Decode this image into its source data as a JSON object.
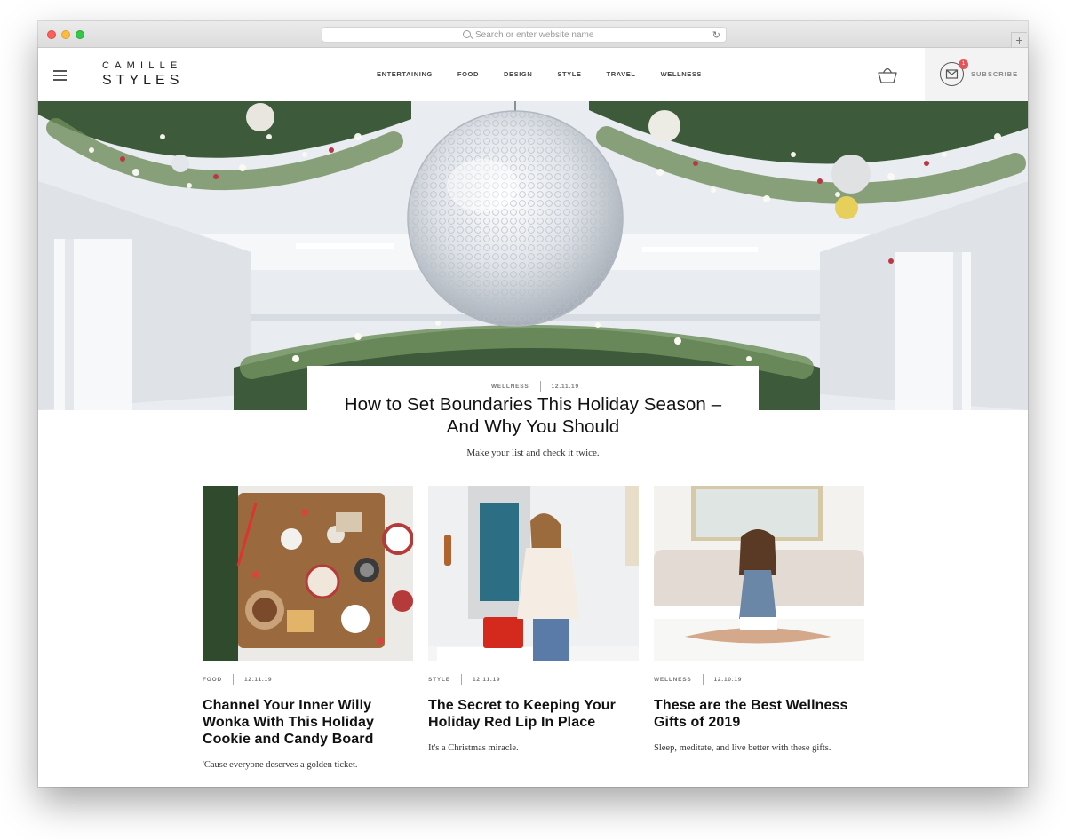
{
  "browser": {
    "url_placeholder": "Search or enter website name",
    "reload_icon": "reload-icon",
    "new_tab_label": "+"
  },
  "site": {
    "logo_line1": "CAMILLE",
    "logo_line2": "STYLES",
    "nav": [
      "ENTERTAINING",
      "FOOD",
      "DESIGN",
      "STYLE",
      "TRAVEL",
      "WELLNESS"
    ],
    "subscribe_label": "SUBSCRIBE",
    "subscribe_badge": "1",
    "icons": [
      "hamburger-menu-icon",
      "shopping-basket-icon",
      "envelope-icon"
    ]
  },
  "hero": {
    "category": "WELLNESS",
    "date": "12.11.19",
    "title": "How to Set Boundaries This Holiday Season – And Why You Should",
    "subtitle": "Make your list and check it twice."
  },
  "posts": [
    {
      "category": "FOOD",
      "date": "12.11.19",
      "title": "Channel Your Inner Willy Wonka With This Holiday Cookie and Candy Board",
      "excerpt": "'Cause everyone deserves a golden ticket."
    },
    {
      "category": "STYLE",
      "date": "12.11.19",
      "title": "The Secret to Keeping Your Holiday Red Lip In Place",
      "excerpt": "It's a Christmas miracle."
    },
    {
      "category": "WELLNESS",
      "date": "12.10.19",
      "title": "These are the Best Wellness Gifts of 2019",
      "excerpt": "Sleep, meditate, and live better with these gifts."
    }
  ],
  "colors": {
    "badge": "#e4555a",
    "subscribe_bg": "#f3f3f3",
    "text": "#111111"
  }
}
